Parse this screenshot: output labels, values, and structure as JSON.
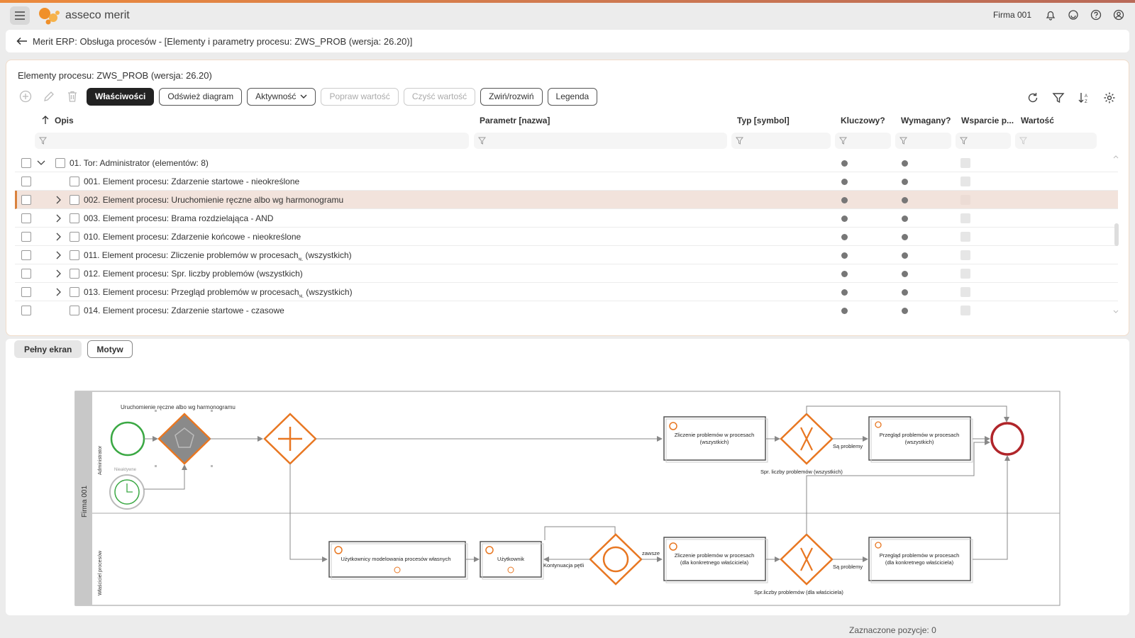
{
  "app": {
    "brand": "asseco merit",
    "company": "Firma 001"
  },
  "titlebar": {
    "title": "Merit ERP: Obsługa procesów - [Elementy i parametry procesu: ZWS_PROB (wersja: 26.20)]"
  },
  "panel": {
    "title": "Elementy procesu: ZWS_PROB (wersja: 26.20)",
    "toolbar": {
      "properties": "Właściwości",
      "refresh_diagram": "Odśwież diagram",
      "activity": "Aktywność",
      "fix_value": "Popraw wartość",
      "clear_value": "Czyść wartość",
      "collapse_expand": "Zwiń/rozwiń",
      "legend": "Legenda"
    },
    "columns": {
      "opis": "Opis",
      "parametr": "Parametr [nazwa]",
      "typ": "Typ [symbol]",
      "kluczowy": "Kluczowy?",
      "wymagany": "Wymagany?",
      "wsparcie": "Wsparcie p...",
      "wartosc": "Wartość"
    },
    "rows": [
      {
        "label": "01. Tor: Administrator (elementów: 8)"
      },
      {
        "label": "001. Element procesu: Zdarzenie startowe - nieokreślone"
      },
      {
        "label": "002. Element procesu: Uruchomienie ręczne albo wg harmonogramu"
      },
      {
        "label": "003. Element procesu: Brama rozdzielająca - AND"
      },
      {
        "label": "010. Element procesu: Zdarzenie końcowe - nieokreślone"
      },
      {
        "label": "011. Element procesu: Zliczenie problemów w procesach",
        "suffix": "(wszystkich)"
      },
      {
        "label": "012. Element procesu: Spr. liczby problemów (wszystkich)"
      },
      {
        "label": "013. Element procesu: Przegląd problemów w procesach",
        "suffix": "(wszystkich)"
      },
      {
        "label": "014. Element procesu: Zdarzenie startowe - czasowe"
      }
    ],
    "sub_mark": "NL"
  },
  "lower": {
    "fullscreen": "Pełny ekran",
    "theme": "Motyw"
  },
  "diagram": {
    "pool": "Firma 001",
    "lane_admin": "Administrator",
    "lane_owner": "Właściciel procesów",
    "manual_start": "Uruchomienie ręczne albo wg harmonogramu",
    "timer_label": "Nieaktywne",
    "task_count_all": [
      "Zliczenie problemów w procesach",
      "(wszystkich)"
    ],
    "task_review_all": [
      "Przegląd problemów w procesach",
      "(wszystkich)"
    ],
    "gw_check_all": "Spr. liczby problemów (wszystkich)",
    "flow_problems": "Są problemy",
    "task_users_modelling": "Użytkownicy modelowania procesów własnych",
    "task_user": "Użytkownik",
    "flow_continue": "Kontynuacja pętli",
    "flow_always": "zawsze",
    "task_count_owner": [
      "Zliczenie problemów w procesach",
      "(dla konkretnego właściciela)"
    ],
    "task_review_owner": [
      "Przegląd problemów w procesach",
      "(dla konkretnego właściciela)"
    ],
    "gw_check_owner": "Spr.liczby problemów (dla właściciela)",
    "flow_problems_2": "Są problemy"
  },
  "status": {
    "selected": "Zaznaczone pozycje: 0"
  }
}
